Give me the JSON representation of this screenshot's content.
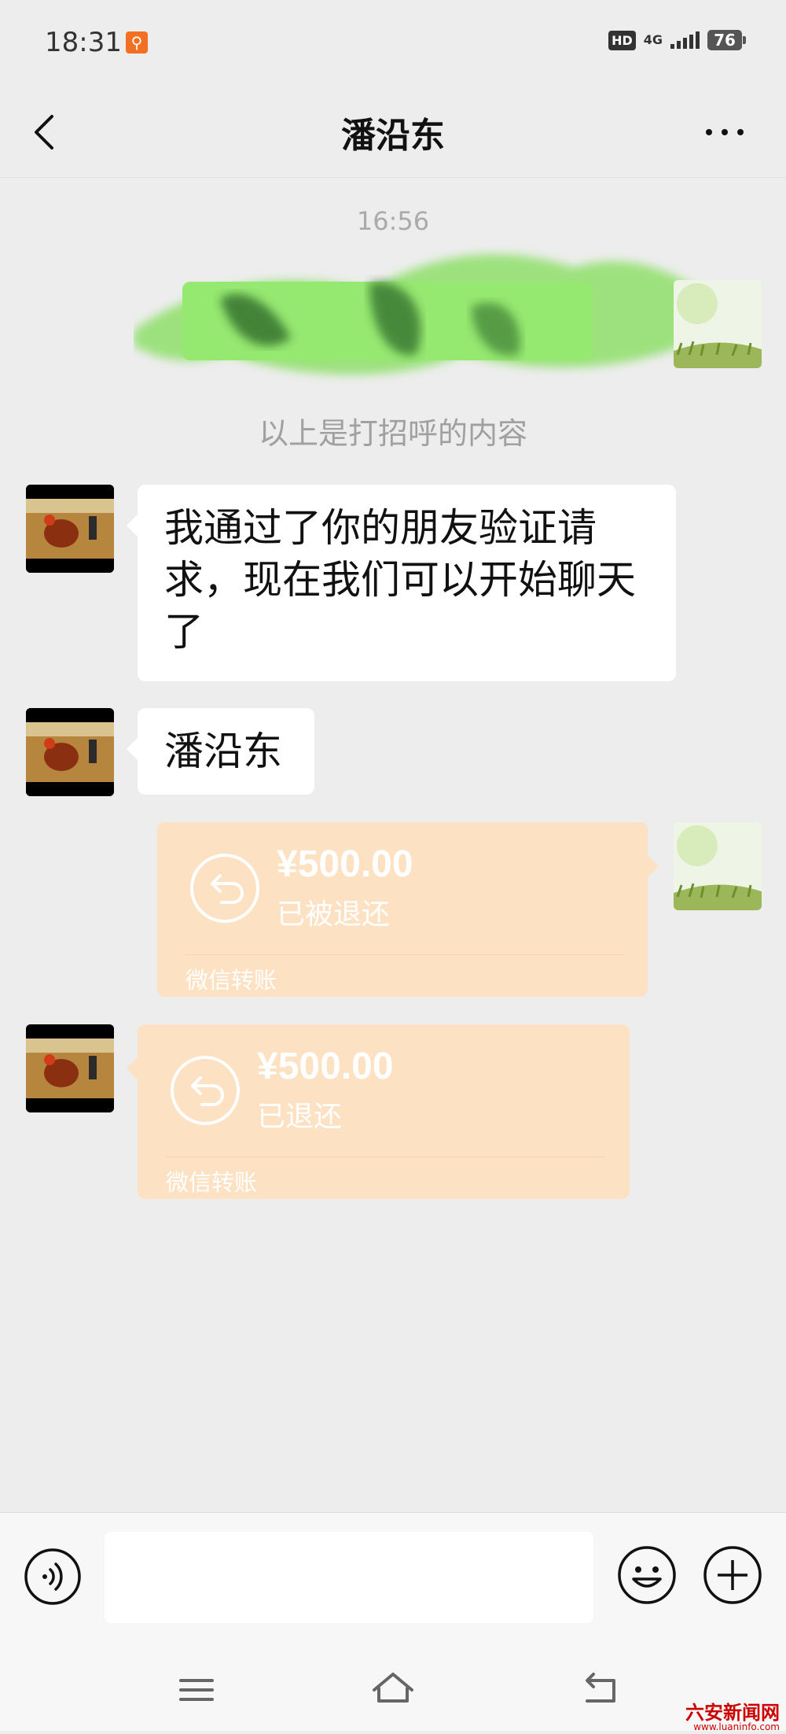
{
  "status_bar": {
    "time": "18:31",
    "hd": "HD",
    "network": "4G",
    "battery": "76"
  },
  "nav": {
    "title": "潘沿东"
  },
  "chat": {
    "timestamp": "16:56",
    "system_note": "以上是打招呼的内容",
    "messages": [
      {
        "side": "left",
        "text": "我通过了你的朋友验证请求，现在我们可以开始聊天了"
      },
      {
        "side": "left",
        "text": "潘沿东"
      }
    ],
    "transfers": [
      {
        "side": "right",
        "amount": "¥500.00",
        "status": "已被退还",
        "label": "微信转账"
      },
      {
        "side": "left",
        "amount": "¥500.00",
        "status": "已退还",
        "label": "微信转账"
      }
    ]
  },
  "input": {
    "value": "",
    "placeholder": ""
  },
  "watermark": {
    "text": "六安新闻网",
    "url": "www.luaninfo.com"
  },
  "colors": {
    "background": "#ededed",
    "bubble": "#ffffff",
    "transfer_refunded": "#fde1c3",
    "redaction": "#7ddc5a"
  }
}
